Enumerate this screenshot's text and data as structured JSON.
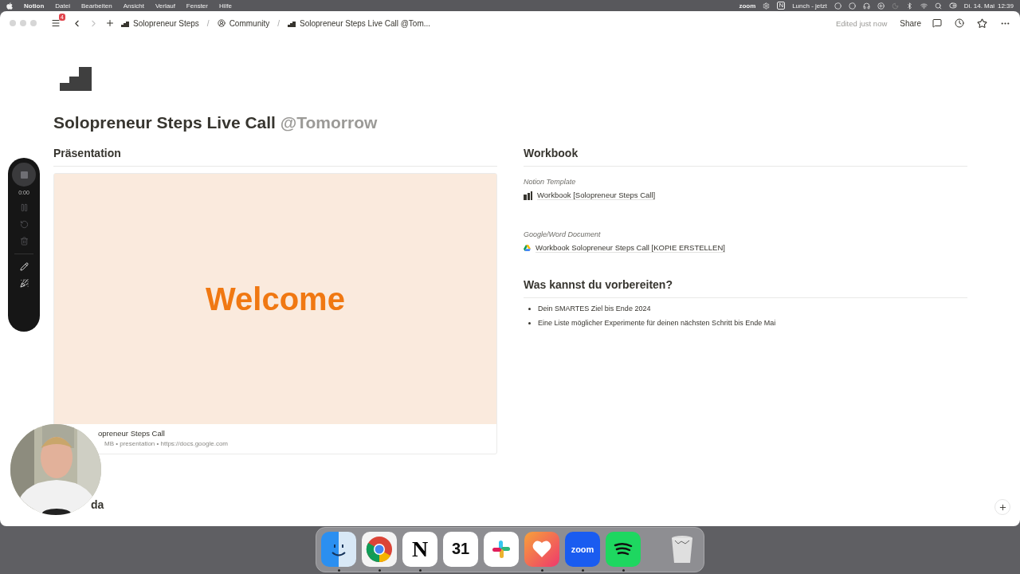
{
  "menubar": {
    "app": "Notion",
    "menus": [
      "Datei",
      "Bearbeiten",
      "Ansicht",
      "Verlauf",
      "Fenster",
      "Hilfe"
    ],
    "status": {
      "zoom": "zoom",
      "notion": "N",
      "event": "Lunch - jetzt",
      "date": "Di. 14. Mai",
      "time": "12:39"
    }
  },
  "window": {
    "inbox_badge": "4",
    "back_disabled": false,
    "forward_disabled": true,
    "breadcrumbs": [
      {
        "kind": "page",
        "label": "Solopreneur Steps"
      },
      {
        "kind": "community",
        "label": "Community",
        "separator": "/"
      },
      {
        "kind": "page",
        "label": "Solopreneur Steps Live Call @Tom...",
        "separator": "/"
      }
    ],
    "edited": "Edited just now",
    "share": "Share"
  },
  "recorder": {
    "timer": "0:00",
    "controls_disabled": true
  },
  "page": {
    "title": "Solopreneur Steps Live Call",
    "mention": "@Tomorrow",
    "left": {
      "heading": "Präsentation",
      "embed": {
        "slide_text": "Welcome",
        "title": "opreneur Steps Call",
        "meta": "MB • presentation • https://docs.google.com"
      }
    },
    "right": {
      "heading": "Workbook",
      "links": [
        {
          "kind": "notion",
          "caption": "Notion Template",
          "label": "Workbook [Solopreneur Steps Call]"
        },
        {
          "kind": "drive",
          "caption": "Google/Word Document",
          "label": "Workbook Solopreneur Steps Call [KOPIE ERSTELLEN]"
        }
      ],
      "heading2": "Was kannst du vorbereiten?",
      "bullets": [
        "Dein SMARTES Ziel bis Ende 2024",
        "Eine Liste möglicher Experimente für deinen nächsten Schritt bis Ende Mai"
      ]
    },
    "next_heading": "da"
  },
  "dock": [
    {
      "kind": "finder",
      "running": true
    },
    {
      "kind": "chrome",
      "running": true
    },
    {
      "kind": "notion",
      "label": "N",
      "running": true
    },
    {
      "kind": "calendar",
      "label": "31",
      "running": false
    },
    {
      "kind": "slack",
      "running": false
    },
    {
      "kind": "heart",
      "running": true
    },
    {
      "kind": "zoom",
      "label": "zoom",
      "running": true
    },
    {
      "kind": "spotify",
      "running": true
    },
    {
      "kind": "trash",
      "running": false
    }
  ]
}
